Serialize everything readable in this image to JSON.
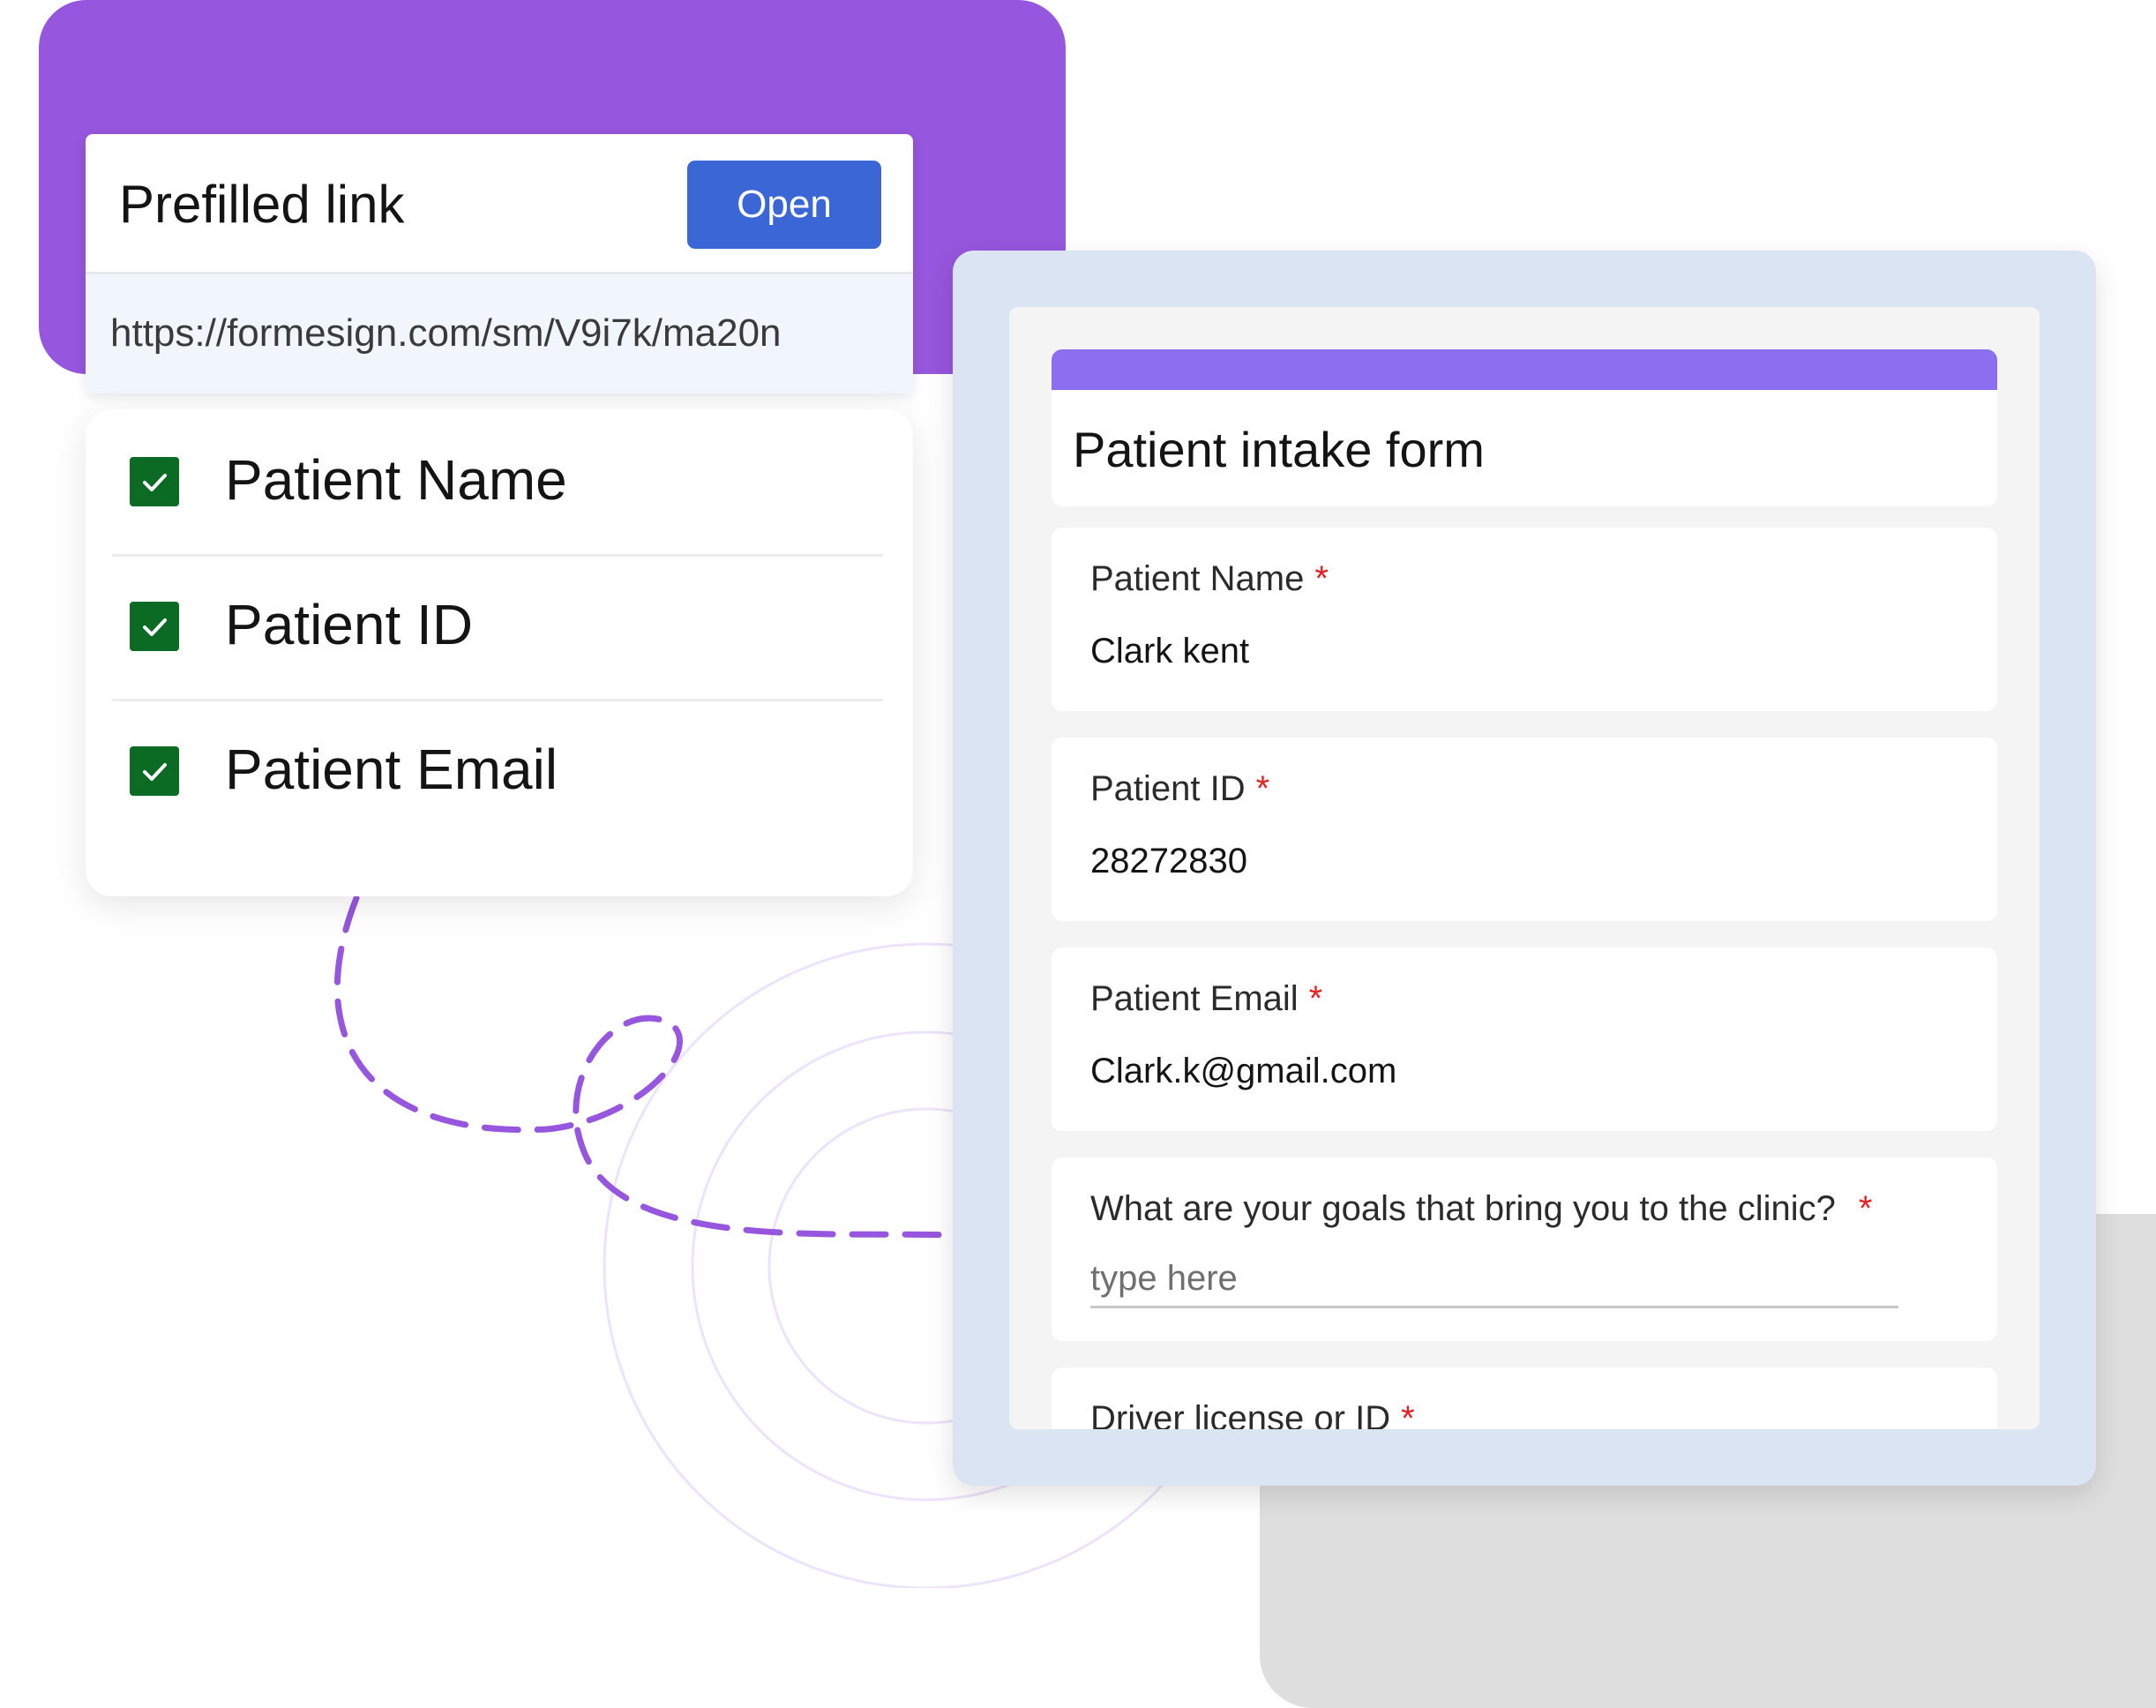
{
  "prefilled_link": {
    "title": "Prefilled link",
    "open_label": "Open",
    "url": "https://formesign.com/sm/V9i7k/ma20n"
  },
  "prefill_fields": [
    {
      "label": "Patient Name",
      "checked": true
    },
    {
      "label": "Patient ID",
      "checked": true
    },
    {
      "label": "Patient Email",
      "checked": true
    }
  ],
  "form": {
    "title": "Patient intake form",
    "required_mark": "*",
    "fields": [
      {
        "label": "Patient Name",
        "value": "Clark kent"
      },
      {
        "label": "Patient ID",
        "value": "28272830"
      },
      {
        "label": "Patient Email",
        "value": "Clark.k@gmail.com"
      },
      {
        "label": "What are your goals that bring you to the clinic?",
        "value": "",
        "placeholder": "type here"
      },
      {
        "label": "Driver license or ID"
      }
    ]
  },
  "colors": {
    "purple_block": "#9656dd",
    "open_button": "#3b67d6",
    "checkbox": "#0b6b24",
    "form_accent": "#8b6ff0",
    "form_frame": "#dbe4f3",
    "required": "#e52222"
  }
}
